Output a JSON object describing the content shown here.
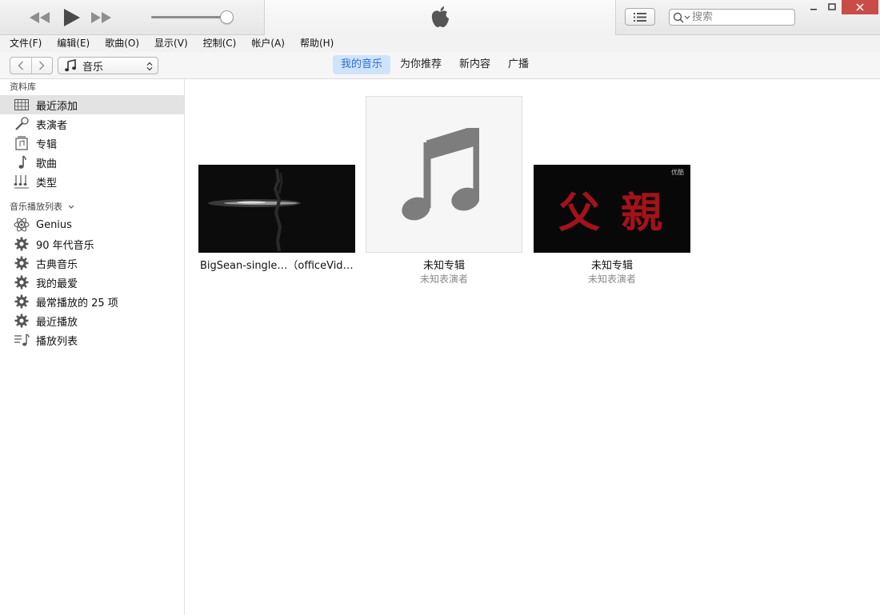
{
  "search": {
    "placeholder": "搜索"
  },
  "menu": [
    "文件(F)",
    "编辑(E)",
    "歌曲(O)",
    "显示(V)",
    "控制(C)",
    "帐户(A)",
    "帮助(H)"
  ],
  "media_selector": {
    "label": "音乐"
  },
  "tabs": [
    {
      "label": "我的音乐",
      "active": true
    },
    {
      "label": "为你推荐"
    },
    {
      "label": "新内容"
    },
    {
      "label": "广播"
    }
  ],
  "volume_level": 0.9,
  "sidebar": {
    "library_header": "资料库",
    "library": [
      {
        "label": "最近添加",
        "icon": "grid-icon",
        "selected": true
      },
      {
        "label": "表演者",
        "icon": "microphone-icon"
      },
      {
        "label": "专辑",
        "icon": "album-icon"
      },
      {
        "label": "歌曲",
        "icon": "music-note-icon"
      },
      {
        "label": "类型",
        "icon": "genre-icon"
      }
    ],
    "playlists_header": "音乐播放列表",
    "playlists": [
      {
        "label": "Genius",
        "icon": "atom-icon"
      },
      {
        "label": "90 年代音乐",
        "icon": "gear-icon"
      },
      {
        "label": "古典音乐",
        "icon": "gear-icon"
      },
      {
        "label": "我的最爱",
        "icon": "gear-icon"
      },
      {
        "label": "最常播放的 25 项",
        "icon": "gear-icon"
      },
      {
        "label": "最近播放",
        "icon": "gear-icon"
      },
      {
        "label": "播放列表",
        "icon": "playlist-icon"
      }
    ]
  },
  "albums": [
    {
      "title": "BigSean-single…（officeVide…",
      "artist": ""
    },
    {
      "title": "未知专辑",
      "artist": "未知表演者"
    },
    {
      "title": "未知专辑",
      "artist": "未知表演者"
    }
  ],
  "cover3": {
    "chars": "父 親",
    "watermark": "优酷"
  }
}
